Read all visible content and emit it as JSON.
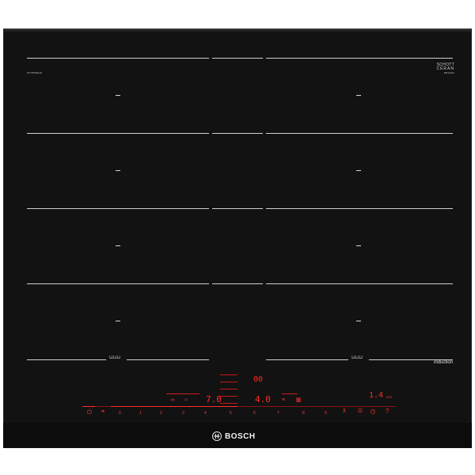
{
  "brand": {
    "name": "BOSCH"
  },
  "glass": {
    "maker_line1": "SCHOTT",
    "maker_line2": "CERAN",
    "maker_sub": "DESIGN",
    "model_code": "PXY875DE1E"
  },
  "zones": {
    "induction_label": "induction",
    "flex_left_label": "⊔⊔⊔",
    "flex_right_label": "⊔⊔⊔"
  },
  "display": {
    "left_power": "7.0",
    "center_power": "4.0",
    "top_center_digits": "00",
    "timer_value": "1.4",
    "timer_unit": "min"
  },
  "controls": {
    "scale": [
      "0",
      "1",
      "2",
      "3",
      "4",
      "5",
      "6",
      "7",
      "8",
      "9"
    ],
    "power_icon": "power-icon",
    "childlock_icon": "childlock-icon",
    "menu_icon": "menu-icon",
    "timer_icon": "timer-icon"
  },
  "colors": {
    "glass": "#121212",
    "accent_red": "#ff2a2a",
    "zone_line": "#cfcfcf"
  }
}
